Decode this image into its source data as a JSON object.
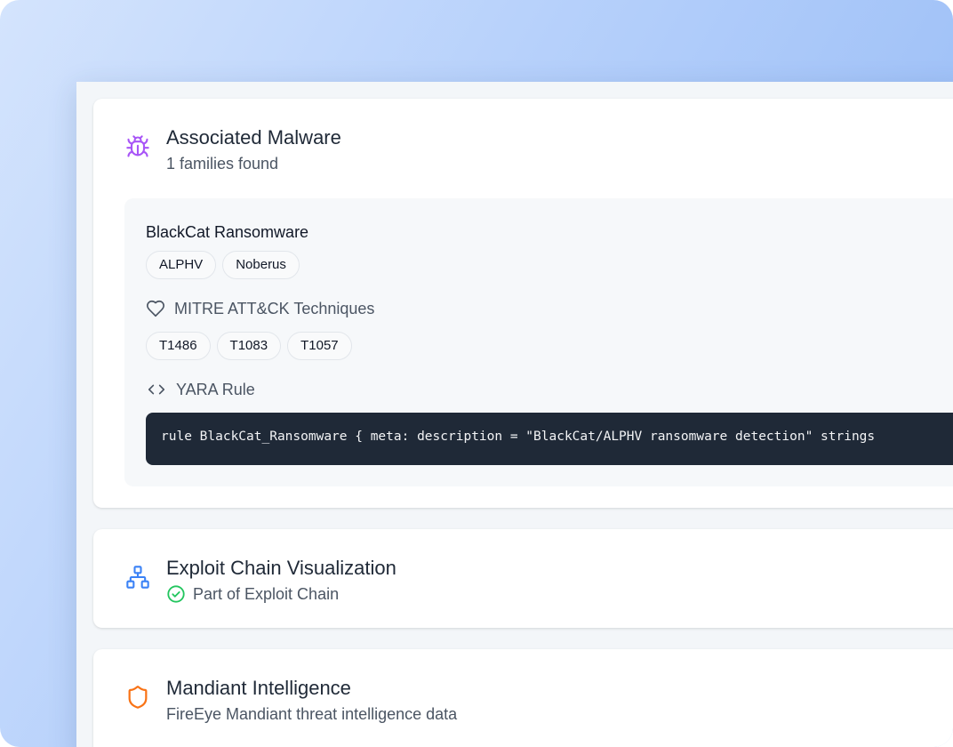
{
  "malware": {
    "title": "Associated Malware",
    "subtitle": "1 families found",
    "icon": "bug-icon",
    "accent": "#a855f7",
    "family": {
      "name": "BlackCat Ransomware",
      "aliases": [
        "ALPHV",
        "Noberus"
      ],
      "mitre_label": "MITRE ATT&CK Techniques",
      "techniques": [
        "T1486",
        "T1083",
        "T1057"
      ],
      "yara_label": "YARA Rule",
      "yara_rule": "rule BlackCat_Ransomware { meta: description = \"BlackCat/ALPHV ransomware detection\" strings"
    }
  },
  "exploit_chain": {
    "title": "Exploit Chain Visualization",
    "status": "Part of Exploit Chain",
    "icon": "network-icon",
    "status_icon": "check-circle-icon",
    "accent": "#3b82f6",
    "status_color": "#22c55e"
  },
  "mandiant": {
    "title": "Mandiant Intelligence",
    "subtitle": "FireEye Mandiant threat intelligence data",
    "icon": "shield-icon",
    "accent": "#f97316"
  }
}
